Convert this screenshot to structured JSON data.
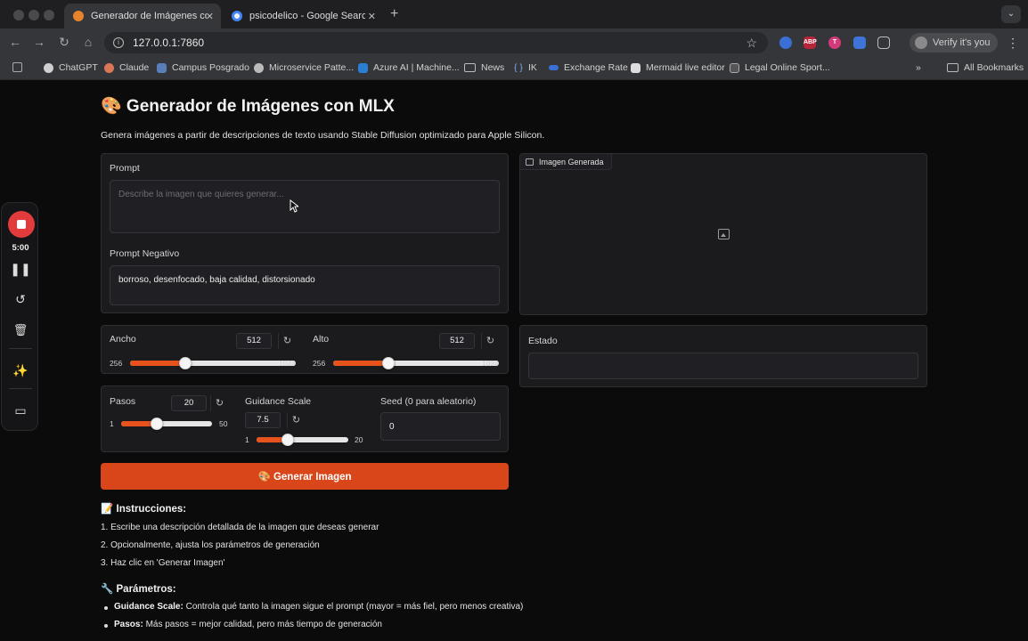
{
  "browser": {
    "tabs": [
      {
        "title": "Generador de Imágenes con MLX",
        "active": true
      },
      {
        "title": "psicodelico - Google Search",
        "active": false
      }
    ],
    "url": "127.0.0.1:7860",
    "profile_label": "Verify it's you",
    "bookmarks": [
      "ChatGPT",
      "Claude",
      "Campus Posgrado",
      "Microservice Patte...",
      "Azure AI | Machine...",
      "News",
      "IK",
      "Exchange Rate",
      "Mermaid live editor",
      "Legal Online Sport..."
    ],
    "all_bookmarks": "All Bookmarks",
    "extensions": [
      "ABP",
      "T"
    ]
  },
  "recorder": {
    "time": "5:00"
  },
  "app": {
    "title": "🎨 Generador de Imágenes con MLX",
    "description": "Genera imágenes a partir de descripciones de texto usando Stable Diffusion optimizado para Apple Silicon.",
    "prompt": {
      "label": "Prompt",
      "placeholder": "Describe la imagen que quieres generar...",
      "value": ""
    },
    "negative": {
      "label": "Prompt Negativo",
      "value": "borroso, desenfocado, baja calidad, distorsionado"
    },
    "width": {
      "label": "Ancho",
      "value": "512",
      "min": "256",
      "max": "1024",
      "fraction": 0.333
    },
    "height": {
      "label": "Alto",
      "value": "512",
      "min": "256",
      "max": "1024",
      "fraction": 0.333
    },
    "steps": {
      "label": "Pasos",
      "value": "20",
      "min": "1",
      "max": "50",
      "fraction": 0.388
    },
    "guidance": {
      "label": "Guidance Scale",
      "value": "7.5",
      "min": "1",
      "max": "20",
      "fraction": 0.342
    },
    "seed": {
      "label": "Seed (0 para aleatorio)",
      "value": "0"
    },
    "output": {
      "label": "Imagen Generada"
    },
    "status": {
      "label": "Estado",
      "value": ""
    },
    "generate_label": "🎨 Generar Imagen",
    "instructions": {
      "title": "📝 Instrucciones:",
      "items": [
        "1. Escribe una descripción detallada de la imagen que deseas generar",
        "2. Opcionalmente, ajusta los parámetros de generación",
        "3. Haz clic en 'Generar Imagen'"
      ]
    },
    "parameters": {
      "title": "🔧 Parámetros:",
      "items": [
        {
          "name": "Guidance Scale:",
          "text": " Controla qué tanto la imagen sigue el prompt (mayor = más fiel, pero menos creativa)"
        },
        {
          "name": "Pasos:",
          "text": " Más pasos = mejor calidad, pero más tiempo de generación"
        }
      ]
    }
  },
  "colors": {
    "accent": "#d9461a",
    "slider_fill": "#e8531d",
    "panel": "#1b1b1e",
    "record": "#e23b3b"
  }
}
